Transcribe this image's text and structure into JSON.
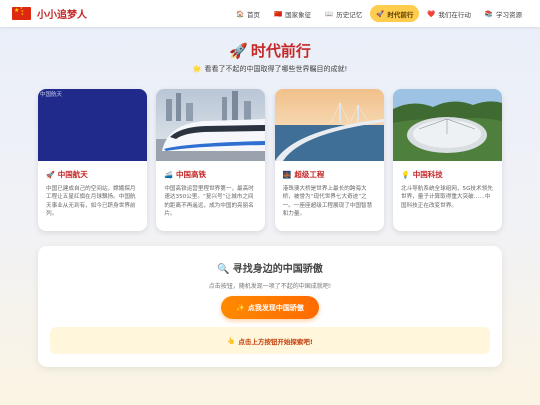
{
  "brand": {
    "name": "小小追梦人",
    "icon": "china-flag-icon"
  },
  "nav": {
    "items": [
      {
        "icon": "🏠",
        "label": "首页",
        "active": false
      },
      {
        "icon": "🇨🇳",
        "label": "国家象征",
        "active": false
      },
      {
        "icon": "📖",
        "label": "历史记忆",
        "active": false
      },
      {
        "icon": "🚀",
        "label": "时代前行",
        "active": true
      },
      {
        "icon": "❤️",
        "label": "我们在行动",
        "active": false
      },
      {
        "icon": "📚",
        "label": "学习资源",
        "active": false
      }
    ]
  },
  "hero": {
    "icon": "🚀",
    "title": "时代前行",
    "subtitle_icon": "🌟",
    "subtitle": "看看了不起的中国取得了哪些世界瞩目的成就!"
  },
  "cards": [
    {
      "image_alt": "中国航天",
      "icon": "🚀",
      "title": "中国航天",
      "desc": "中国已建成自己的空间站，嫦娥探月工程让五星红旗在月球飘扬。中国航天事业从无到有，如今已跻身世界前列。"
    },
    {
      "image_alt": "",
      "icon": "🚄",
      "title": "中国高铁",
      "desc": "中国高铁运营里程世界第一，最高时速达350公里。“复兴号”让城市之间的距离不再遥远，成为中国的亮丽名片。"
    },
    {
      "image_alt": "",
      "icon": "🌉",
      "title": "超级工程",
      "desc": "港珠澳大桥是世界上最长的跨海大桥，被誉为“现代世界七大奇迹”之一。一座座超级工程展现了中国智慧和力量。"
    },
    {
      "image_alt": "",
      "icon": "💡",
      "title": "中国科技",
      "desc": "北斗导航系统全球组网，5G技术领先世界，量子计算取得重大突破……中国科技正在改变世界。"
    }
  ],
  "finder": {
    "icon": "🔍",
    "title": "寻找身边的中国骄傲",
    "subtitle": "点击按钮，随机发现一项了不起的中国成就吧!",
    "button_icon": "✨",
    "button_label": "点我发现中国骄傲",
    "hint_icon": "👆",
    "hint": "点击上方按钮开始探索吧!"
  },
  "colors": {
    "accent_red": "#c62828",
    "nav_active": "#ffcc4d",
    "button_orange": "#ff7a00",
    "hint_bg": "#fff6dc"
  }
}
